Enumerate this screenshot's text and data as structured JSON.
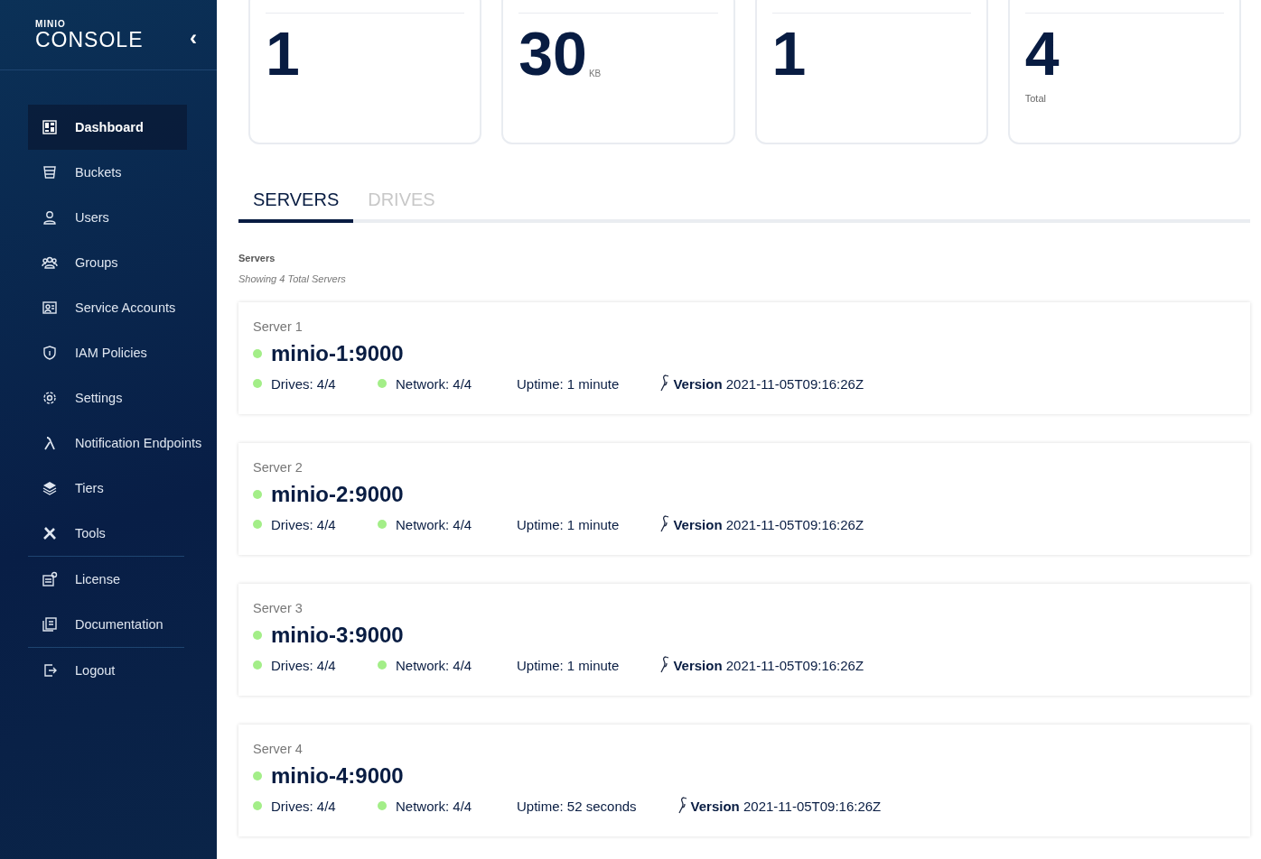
{
  "sidebar": {
    "logo_top": "MINIO",
    "logo_bottom": "CONSOLE",
    "collapse": "‹",
    "sections": [
      {
        "items": [
          {
            "label": "Dashboard",
            "selected": true
          },
          {
            "label": "Buckets",
            "selected": false
          },
          {
            "label": "Users",
            "selected": false
          },
          {
            "label": "Groups",
            "selected": false
          },
          {
            "label": "Service Accounts",
            "selected": false
          },
          {
            "label": "IAM Policies",
            "selected": false
          },
          {
            "label": "Settings",
            "selected": false
          },
          {
            "label": "Notification Endpoints",
            "selected": false
          },
          {
            "label": "Tiers",
            "selected": false
          },
          {
            "label": "Tools",
            "selected": false
          }
        ]
      },
      {
        "items": [
          {
            "label": "License",
            "selected": false
          },
          {
            "label": "Documentation",
            "selected": false
          }
        ]
      },
      {
        "items": [
          {
            "label": "Logout",
            "selected": false
          }
        ]
      }
    ]
  },
  "stats": [
    {
      "value": "1"
    },
    {
      "value": "30",
      "unit": "KB"
    },
    {
      "value": "1"
    },
    {
      "value": "4",
      "caption": "Total"
    }
  ],
  "tabs": [
    {
      "label": "SERVERS",
      "selected": true
    },
    {
      "label": "DRIVES",
      "selected": false
    }
  ],
  "section": {
    "title": "Servers",
    "subtitle": "Showing 4 Total Servers"
  },
  "servers": [
    {
      "label": "Server 1",
      "endpoint": "minio-1:9000",
      "online": true,
      "drives": "Drives: 4/4",
      "drives_ok": true,
      "network": "Network: 4/4",
      "network_ok": true,
      "uptime": "Uptime: 1 minute",
      "version": "**Version** 2021-11-05T09:16:26Z"
    },
    {
      "label": "Server 2",
      "endpoint": "minio-2:9000",
      "online": true,
      "drives": "Drives: 4/4",
      "drives_ok": true,
      "network": "Network: 4/4",
      "network_ok": true,
      "uptime": "Uptime: 1 minute",
      "version": "**Version** 2021-11-05T09:16:26Z"
    },
    {
      "label": "Server 3",
      "endpoint": "minio-3:9000",
      "online": true,
      "drives": "Drives: 4/4",
      "drives_ok": true,
      "network": "Network: 4/4",
      "network_ok": true,
      "uptime": "Uptime: 1 minute",
      "version": "**Version** 2021-11-05T09:16:26Z"
    },
    {
      "label": "Server 4",
      "endpoint": "minio-4:9000",
      "online": true,
      "drives": "Drives: 4/4",
      "drives_ok": true,
      "network": "Network: 4/4",
      "network_ok": true,
      "uptime": "Uptime: 52 seconds",
      "version": "**Version** 2021-11-05T09:16:26Z"
    }
  ]
}
